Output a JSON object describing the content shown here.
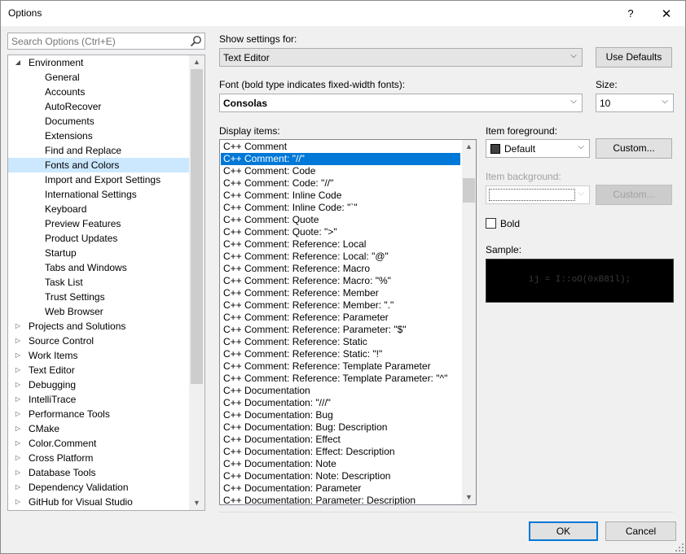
{
  "window": {
    "title": "Options",
    "help": "?",
    "close": "✕"
  },
  "search": {
    "placeholder": "Search Options (Ctrl+E)"
  },
  "tree": {
    "items": [
      {
        "label": "Environment",
        "level": 0,
        "expanded": true
      },
      {
        "label": "General",
        "level": 1
      },
      {
        "label": "Accounts",
        "level": 1
      },
      {
        "label": "AutoRecover",
        "level": 1
      },
      {
        "label": "Documents",
        "level": 1
      },
      {
        "label": "Extensions",
        "level": 1
      },
      {
        "label": "Find and Replace",
        "level": 1
      },
      {
        "label": "Fonts and Colors",
        "level": 1,
        "selected": true
      },
      {
        "label": "Import and Export Settings",
        "level": 1
      },
      {
        "label": "International Settings",
        "level": 1
      },
      {
        "label": "Keyboard",
        "level": 1
      },
      {
        "label": "Preview Features",
        "level": 1
      },
      {
        "label": "Product Updates",
        "level": 1
      },
      {
        "label": "Startup",
        "level": 1
      },
      {
        "label": "Tabs and Windows",
        "level": 1
      },
      {
        "label": "Task List",
        "level": 1
      },
      {
        "label": "Trust Settings",
        "level": 1
      },
      {
        "label": "Web Browser",
        "level": 1
      },
      {
        "label": "Projects and Solutions",
        "level": 0,
        "expanded": false
      },
      {
        "label": "Source Control",
        "level": 0,
        "expanded": false
      },
      {
        "label": "Work Items",
        "level": 0,
        "expanded": false
      },
      {
        "label": "Text Editor",
        "level": 0,
        "expanded": false
      },
      {
        "label": "Debugging",
        "level": 0,
        "expanded": false
      },
      {
        "label": "IntelliTrace",
        "level": 0,
        "expanded": false
      },
      {
        "label": "Performance Tools",
        "level": 0,
        "expanded": false
      },
      {
        "label": "CMake",
        "level": 0,
        "expanded": false
      },
      {
        "label": "Color.Comment",
        "level": 0,
        "expanded": false
      },
      {
        "label": "Cross Platform",
        "level": 0,
        "expanded": false
      },
      {
        "label": "Database Tools",
        "level": 0,
        "expanded": false
      },
      {
        "label": "Dependency Validation",
        "level": 0,
        "expanded": false
      },
      {
        "label": "GitHub for Visual Studio",
        "level": 0,
        "expanded": false
      }
    ]
  },
  "show_settings": {
    "label": "Show settings for:",
    "value": "Text Editor",
    "use_defaults": "Use Defaults"
  },
  "font": {
    "label": "Font (bold type indicates fixed-width fonts):",
    "value": "Consolas"
  },
  "size": {
    "label": "Size:",
    "value": "10"
  },
  "display_items": {
    "label": "Display items:",
    "items": [
      "C++ Comment",
      "C++ Comment: \"//\"",
      "C++ Comment: Code",
      "C++ Comment: Code: \"//\"",
      "C++ Comment: Inline Code",
      "C++ Comment: Inline Code: \"`\"",
      "C++ Comment: Quote",
      "C++ Comment: Quote: \">\"",
      "C++ Comment: Reference: Local",
      "C++ Comment: Reference: Local: \"@\"",
      "C++ Comment: Reference: Macro",
      "C++ Comment: Reference: Macro: \"%\"",
      "C++ Comment: Reference: Member",
      "C++ Comment: Reference: Member: \".\"",
      "C++ Comment: Reference: Parameter",
      "C++ Comment: Reference: Parameter: \"$\"",
      "C++ Comment: Reference: Static",
      "C++ Comment: Reference: Static: \"!\"",
      "C++ Comment: Reference: Template Parameter",
      "C++ Comment: Reference: Template Parameter: \"^\"",
      "C++ Documentation",
      "C++ Documentation: \"///\"",
      "C++ Documentation: Bug",
      "C++ Documentation: Bug: Description",
      "C++ Documentation: Effect",
      "C++ Documentation: Effect: Description",
      "C++ Documentation: Note",
      "C++ Documentation: Note: Description",
      "C++ Documentation: Parameter",
      "C++ Documentation: Parameter: Description"
    ],
    "selected_index": 1
  },
  "item_foreground": {
    "label": "Item foreground:",
    "value": "Default",
    "custom": "Custom...",
    "color": "#3f3f3f"
  },
  "item_background": {
    "label": "Item background:",
    "value": "",
    "custom": "Custom..."
  },
  "bold": {
    "label": "Bold",
    "checked": false
  },
  "sample": {
    "label": "Sample:",
    "text": "ij = I::oO(0xB81l);"
  },
  "buttons": {
    "ok": "OK",
    "cancel": "Cancel"
  },
  "colors": {
    "accent": "#0078d7",
    "tree_selected": "#cce8ff"
  }
}
